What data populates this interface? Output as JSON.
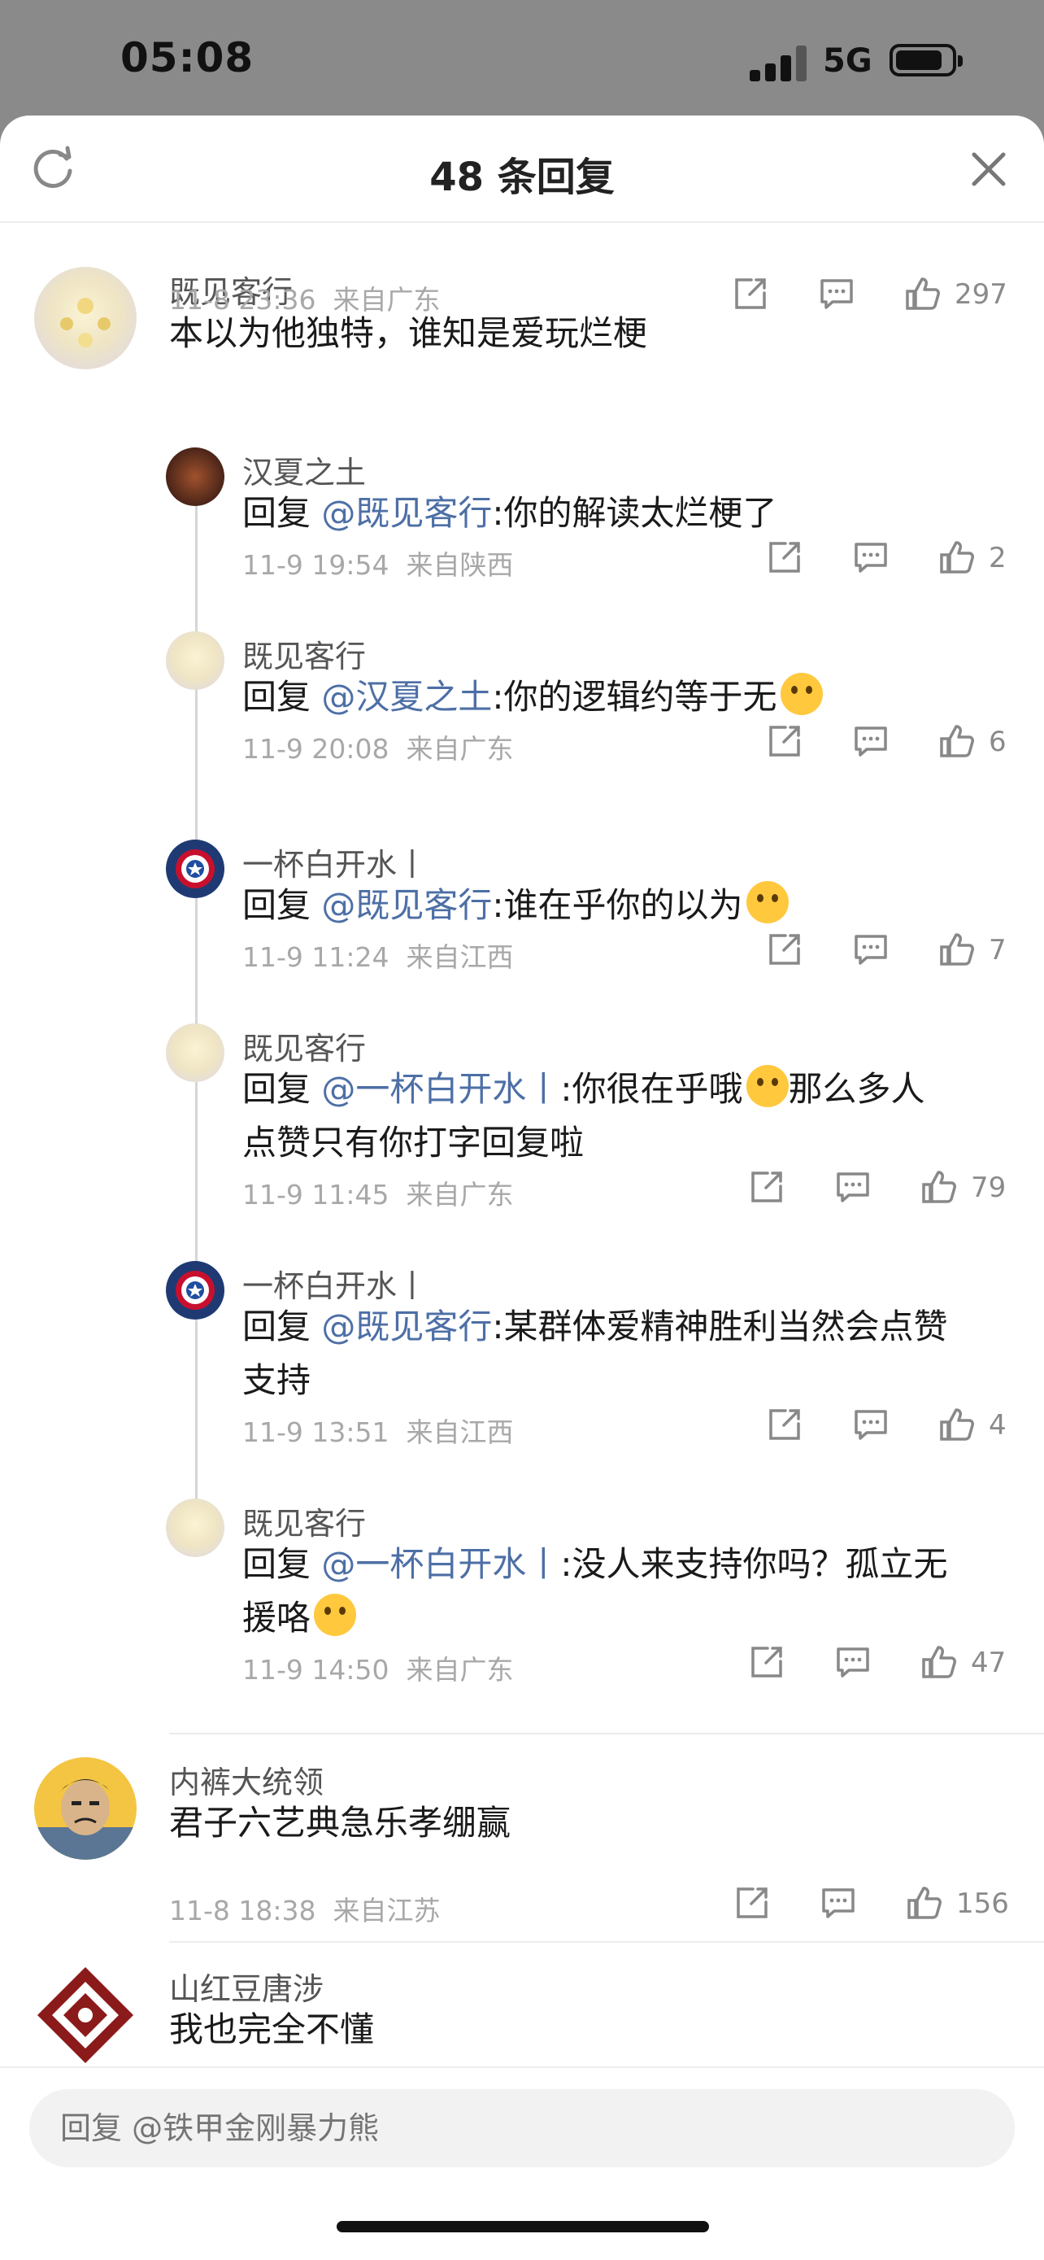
{
  "status": {
    "time": "05:08",
    "network": "5G"
  },
  "header": {
    "title": "48 条回复"
  },
  "comments": [
    {
      "name": "既见客行",
      "text": "本以为他独特，谁知是爱玩烂梗",
      "time": "11-8 23:36",
      "location": "来自广东",
      "likes": "297"
    },
    {
      "name": "汉夏之土",
      "prefix": "回复 ",
      "mention": "@既见客行",
      "text": ":你的解读太烂梗了",
      "time": "11-9 19:54",
      "location": "来自陕西",
      "likes": "2"
    },
    {
      "name": "既见客行",
      "prefix": "回复 ",
      "mention": "@汉夏之土",
      "text": ":你的逻辑约等于无",
      "time": "11-9 20:08",
      "location": "来自广东",
      "likes": "6",
      "emoji": "astonished-emoji"
    },
    {
      "name": "一杯白开水丨",
      "prefix": "回复 ",
      "mention": "@既见客行",
      "text": ":谁在乎你的以为",
      "time": "11-9 11:24",
      "location": "来自江西",
      "likes": "7",
      "emoji": "laugh-cry-emoji"
    },
    {
      "name": "既见客行",
      "prefix": "回复 ",
      "mention": "@一杯白开水丨",
      "text": ":你很在乎哦",
      "text_after_emoji": "那么多人",
      "text_line2": "点赞只有你打字回复啦",
      "time": "11-9 11:45",
      "location": "来自广东",
      "likes": "79",
      "emoji": "tongue-emoji"
    },
    {
      "name": "一杯白开水丨",
      "prefix": "回复 ",
      "mention": "@既见客行",
      "text": ":某群体爱精神胜利当然会点赞",
      "text_line2": "支持",
      "time": "11-9 13:51",
      "location": "来自江西",
      "likes": "4"
    },
    {
      "name": "既见客行",
      "prefix": "回复 ",
      "mention": "@一杯白开水丨",
      "text": ":没人来支持你吗？孤立无",
      "text_line2": "援咯",
      "time": "11-9 14:50",
      "location": "来自广东",
      "likes": "47",
      "emoji": "smirk-emoji"
    },
    {
      "name": "内裤大统领",
      "text": "君子六艺典急乐孝绷赢",
      "time": "11-8 18:38",
      "location": "来自江苏",
      "likes": "156"
    },
    {
      "name": "山红豆唐涉",
      "text": "我也完全不懂"
    }
  ],
  "reply": {
    "placeholder": "回复 @铁甲金刚暴力熊"
  },
  "colors": {
    "mention": "#4d6fa6",
    "meta": "#a8a8a8",
    "background_dim": "#8a8a8a"
  }
}
